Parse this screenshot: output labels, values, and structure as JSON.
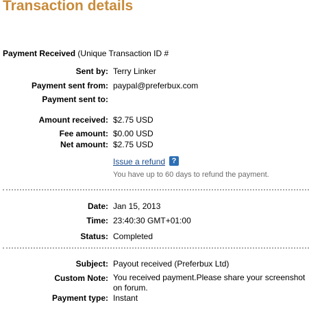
{
  "page_title": "Transaction details",
  "headline": {
    "status_label": "Payment Received",
    "id_text": "(Unique Transaction ID #"
  },
  "sender": {
    "sent_by_label": "Sent by:",
    "sent_by_value": "Terry Linker",
    "sent_from_label": "Payment sent from:",
    "sent_from_value": "paypal@preferbux.com",
    "sent_to_label": "Payment sent to:",
    "sent_to_value": ""
  },
  "amounts": {
    "received_label": "Amount received:",
    "received_value": "$2.75 USD",
    "fee_label": "Fee amount:",
    "fee_value": "$0.00 USD",
    "net_label": "Net amount:",
    "net_value": "$2.75 USD"
  },
  "refund": {
    "link_text": "Issue a refund",
    "help_icon": "?",
    "note": "You have up to 60 days to refund the payment."
  },
  "timing": {
    "date_label": "Date:",
    "date_value": "Jan 15, 2013",
    "time_label": "Time:",
    "time_value": "23:40:30 GMT+01:00",
    "status_label": "Status:",
    "status_value": "Completed"
  },
  "details": {
    "subject_label": "Subject:",
    "subject_value": "Payout received (Preferbux Ltd)",
    "note_label": "Custom Note:",
    "note_value": "You received payment.Please share your screenshot on forum.",
    "type_label": "Payment type:",
    "type_value": "Instant"
  },
  "colors": {
    "title": "#c98b3a",
    "link": "#1a4b8e",
    "help_icon_bg": "#2d6fb5",
    "note_text": "#6b6b6b",
    "divider": "#a8a8a8"
  }
}
